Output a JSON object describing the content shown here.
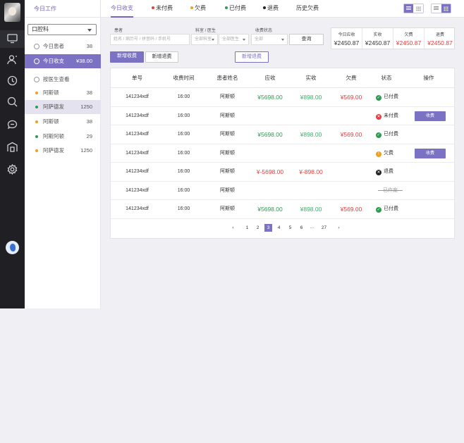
{
  "sidebar_rail": {
    "icons": [
      "monitor-icon",
      "user-icon",
      "clock-icon",
      "search-icon",
      "chat-icon",
      "building-icon",
      "gear-icon"
    ]
  },
  "workspace": {
    "title": "今日工作",
    "department": "口腔科",
    "items": [
      {
        "label": "今日患者",
        "count": "38"
      },
      {
        "label": "今日收支",
        "count": "¥38.00"
      }
    ],
    "doctor_section": "按医生查看",
    "doctors": [
      {
        "name": "阿斯顿",
        "count": "38",
        "color": "#f0a020"
      },
      {
        "name": "阿萨德发",
        "count": "1250",
        "color": "#2e9a52"
      },
      {
        "name": "阿斯顿",
        "count": "38",
        "color": "#f0a020"
      },
      {
        "name": "阿斯阿顿",
        "count": "29",
        "color": "#2e9a52"
      },
      {
        "name": "阿萨德发",
        "count": "1250",
        "color": "#f0a020"
      }
    ]
  },
  "tabs": [
    {
      "label": "今日收支",
      "dot": ""
    },
    {
      "label": "未付费",
      "dot": "#e04040"
    },
    {
      "label": "欠费",
      "dot": "#f0a020"
    },
    {
      "label": "已付费",
      "dot": "#2e9a52"
    },
    {
      "label": "退费",
      "dot": "#222222"
    },
    {
      "label": "历史欠费",
      "dot": ""
    }
  ],
  "filters": {
    "patient_label": "患者",
    "patient_placeholder": "姓名 / 病历号 / 拼音码 / 手机号",
    "dept_label": "科室 / 医生",
    "dept_value": "全部科室",
    "doctor_value": "全部医生",
    "status_label": "收费状态",
    "status_value": "全部",
    "query_label": "查询"
  },
  "summary": [
    {
      "label": "今日应收",
      "value": "¥2450.87",
      "red": false
    },
    {
      "label": "实收",
      "value": "¥2450.87",
      "red": false
    },
    {
      "label": "欠费",
      "value": "¥2450.87",
      "red": true
    },
    {
      "label": "退费",
      "value": "¥2450.87",
      "red": true
    }
  ],
  "actions": {
    "new_charge": "新增收费",
    "new_refund": "新增退费",
    "new_refund2": "新增退费"
  },
  "table": {
    "headers": [
      "单号",
      "收费时间",
      "患者姓名",
      "应收",
      "实收",
      "欠费",
      "状态",
      "操作"
    ],
    "rows": [
      {
        "id": "141234xdf",
        "time": "16:00",
        "name": "阿斯顿",
        "due": "¥5698.00",
        "paid": "¥898.00",
        "owe": "¥569.00",
        "status": "已付费",
        "status_type": "paid",
        "action": "",
        "negative": false
      },
      {
        "id": "141234xdf",
        "time": "16:00",
        "name": "阿斯顿",
        "due": "",
        "paid": "",
        "owe": "",
        "status": "未付费",
        "status_type": "unpaid",
        "action": "收费",
        "negative": false
      },
      {
        "id": "141234xdf",
        "time": "16:00",
        "name": "阿斯顿",
        "due": "¥5698.00",
        "paid": "¥898.00",
        "owe": "¥569.00",
        "status": "已付费",
        "status_type": "paid",
        "action": "",
        "negative": false
      },
      {
        "id": "141234xdf",
        "time": "16:00",
        "name": "阿斯顿",
        "due": "",
        "paid": "",
        "owe": "",
        "status": "欠费",
        "status_type": "owe",
        "action": "收费",
        "negative": false
      },
      {
        "id": "141234xdf",
        "time": "16:00",
        "name": "阿斯顿",
        "due": "¥-5698.00",
        "paid": "¥-898.00",
        "owe": "",
        "status": "退费",
        "status_type": "refund",
        "action": "",
        "negative": true
      },
      {
        "id": "141234xdf",
        "time": "16:00",
        "name": "阿斯顿",
        "due": "",
        "paid": "",
        "owe": "",
        "status": "已作废",
        "status_type": "void",
        "action": "",
        "negative": false
      },
      {
        "id": "141234xdf",
        "time": "16:00",
        "name": "阿斯顿",
        "due": "¥5698.00",
        "paid": "¥898.00",
        "owe": "¥569.00",
        "status": "已付费",
        "status_type": "paid",
        "action": "",
        "negative": false
      }
    ]
  },
  "pagination": {
    "prev": "‹",
    "pages": [
      "1",
      "2",
      "3",
      "4",
      "5",
      "6",
      "···",
      "27"
    ],
    "current": "3",
    "next": "›"
  },
  "colors": {
    "accent": "#7b72c4",
    "green": "#2e9a52",
    "red": "#e04040",
    "orange": "#f0a020"
  }
}
